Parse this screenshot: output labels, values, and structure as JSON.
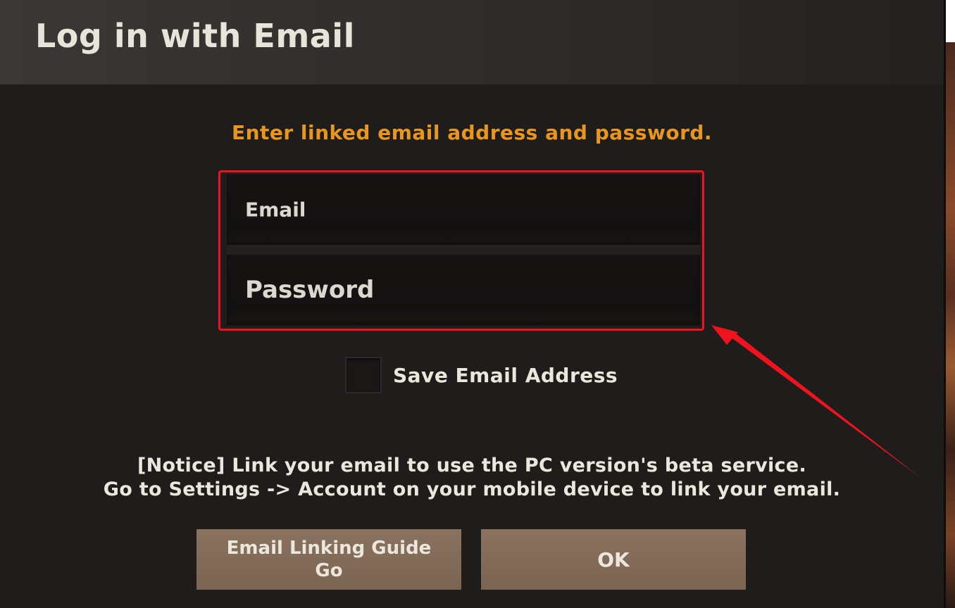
{
  "dialog": {
    "title": "Log in with Email",
    "instruction": "Enter linked email address and password.",
    "fields": {
      "email_placeholder": "Email",
      "password_placeholder": "Password"
    },
    "save_email": {
      "label": "Save Email Address",
      "checked": false
    },
    "notice": {
      "line1": "[Notice] Link your email to use the PC version's beta service.",
      "line2": "Go to Settings -> Account on your mobile device to link your email."
    },
    "buttons": {
      "guide_line1": "Email Linking Guide",
      "guide_line2": "Go",
      "ok": "OK"
    }
  },
  "colors": {
    "background": "#1f1d1b",
    "header": "#3a3835",
    "accent_orange": "#e8961e",
    "highlight_red": "#f0131e",
    "button": "#8a7260",
    "text": "#ece7dd"
  }
}
